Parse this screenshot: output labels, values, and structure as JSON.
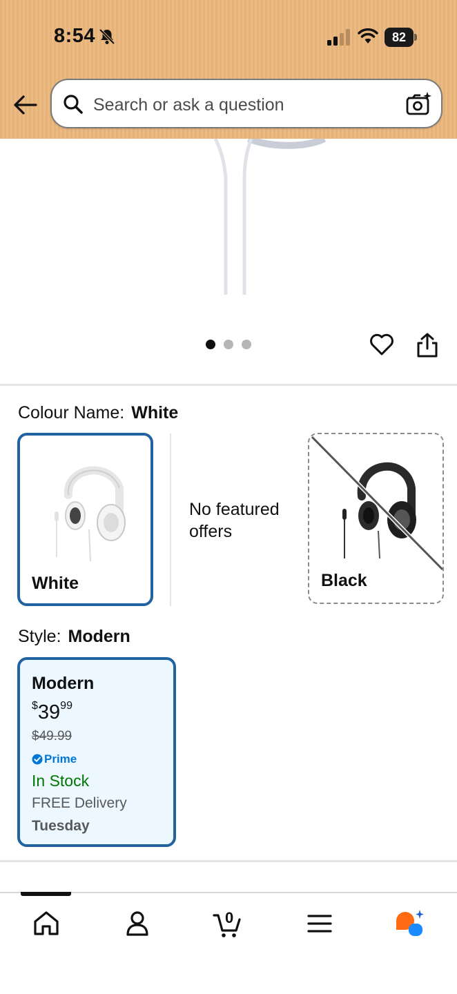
{
  "status_bar": {
    "time": "8:54",
    "battery": "82"
  },
  "search": {
    "placeholder": "Search or ask a question"
  },
  "gallery": {
    "image_count": 3,
    "active_index": 0
  },
  "colour": {
    "label": "Colour Name:",
    "selected": "White",
    "options": [
      {
        "name": "White",
        "state": "selected"
      },
      {
        "name": "Black",
        "state": "unavailable"
      }
    ],
    "no_offers_text": "No featured offers"
  },
  "style": {
    "label": "Style:",
    "selected": "Modern",
    "card": {
      "title": "Modern",
      "price_symbol": "$",
      "price_whole": "39",
      "price_fraction": "99",
      "list_price": "$49.99",
      "prime": "Prime",
      "stock": "In Stock",
      "delivery": "FREE Delivery",
      "delivery_day": "Tuesday"
    }
  },
  "bottom_nav": {
    "items": [
      {
        "icon": "home-icon",
        "active": true
      },
      {
        "icon": "account-icon",
        "active": false
      },
      {
        "icon": "cart-icon",
        "active": false
      },
      {
        "icon": "menu-icon",
        "active": false
      },
      {
        "icon": "rufus-assistant-icon",
        "active": false
      }
    ],
    "cart_count": "0"
  },
  "colors": {
    "header": "#e8b67e",
    "selected_border": "#2162a1",
    "style_card_bg": "#edf7ff",
    "in_stock": "#007600",
    "prime": "#0076d6"
  }
}
